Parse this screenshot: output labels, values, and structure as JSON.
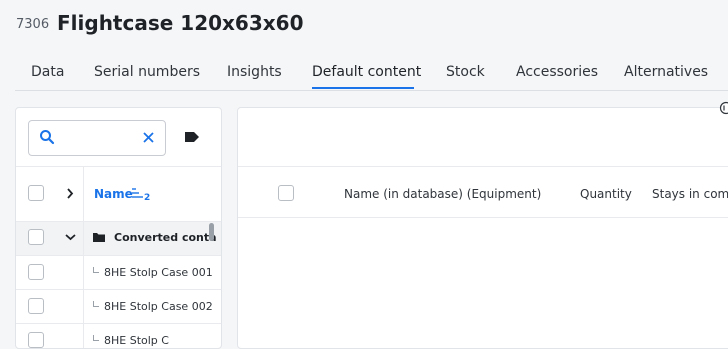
{
  "header": {
    "item_id": "7306",
    "title": "Flightcase 120x63x60"
  },
  "tabs": [
    {
      "label": "Data"
    },
    {
      "label": "Serial numbers"
    },
    {
      "label": "Insights"
    },
    {
      "label": "Default content",
      "active": true
    },
    {
      "label": "Stock"
    },
    {
      "label": "Accessories"
    },
    {
      "label": "Alternatives"
    }
  ],
  "left_panel": {
    "search": {
      "value": "",
      "placeholder": ""
    },
    "column_name": "Name",
    "sort_order": "2",
    "group": {
      "label": "Converted conta"
    },
    "children": [
      {
        "label": "8HE Stolp Case 001"
      },
      {
        "label": "8HE Stolp Case 002"
      },
      {
        "label": "8HE Stolp C"
      }
    ]
  },
  "right_panel": {
    "columns": [
      {
        "label": "Name (in database) (Equipment)"
      },
      {
        "label": "Quantity"
      },
      {
        "label": "Stays in comb"
      }
    ]
  },
  "colors": {
    "accent": "#1a73e8",
    "text": "#1f2328",
    "border": "#e1e4e8",
    "background": "#f5f6f8"
  }
}
